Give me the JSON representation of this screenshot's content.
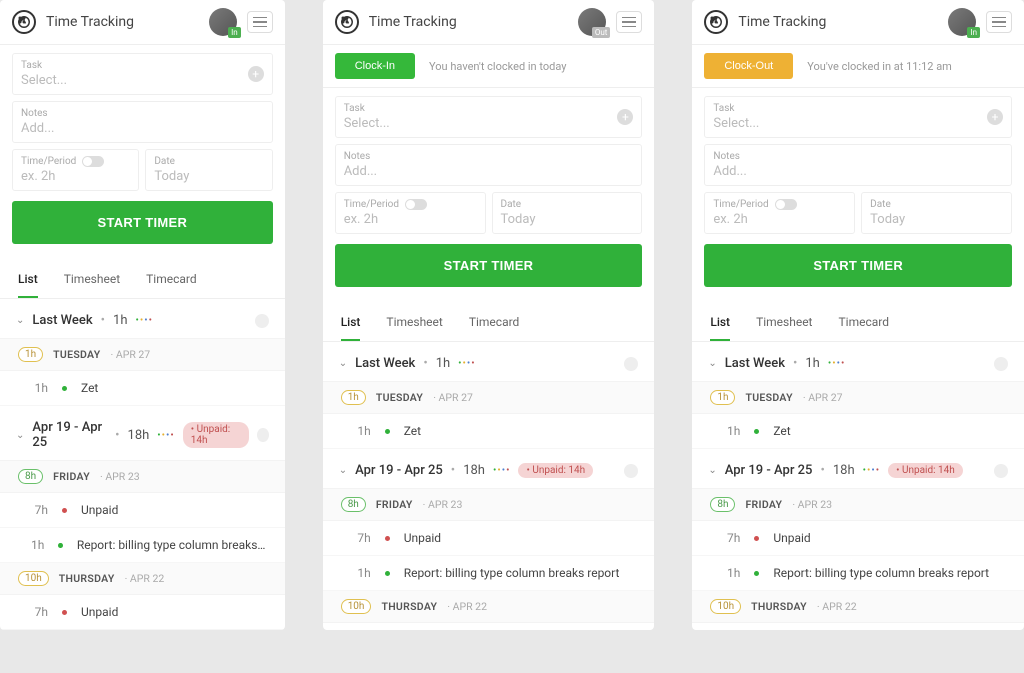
{
  "panels": [
    {
      "title": "Time Tracking",
      "badge": "In",
      "badgeClass": "badge-in",
      "clock": null,
      "form": {
        "task_label": "Task",
        "task_ph": "Select...",
        "notes_label": "Notes",
        "notes_ph": "Add...",
        "time_label": "Time/Period",
        "time_ph": "ex. 2h",
        "date_label": "Date",
        "date_ph": "Today",
        "start": "START TIMER"
      },
      "tabs": [
        "List",
        "Timesheet",
        "Timecard"
      ],
      "active_tab": 0,
      "groups": [
        {
          "name": "Last Week",
          "hours": "1h",
          "dots": "••••",
          "unpaid": null,
          "days": [
            {
              "pill": "1h",
              "pillClass": "",
              "day": "TUESDAY",
              "date": "APR 27",
              "entries": [
                {
                  "h": "1h",
                  "dot": "green",
                  "text": "Zet"
                }
              ]
            }
          ]
        },
        {
          "name": "Apr 19 - Apr 25",
          "hours": "18h",
          "dots": "•••••",
          "unpaid": "Unpaid: 14h",
          "days": [
            {
              "pill": "8h",
              "pillClass": "green",
              "day": "FRIDAY",
              "date": "APR 23",
              "entries": [
                {
                  "h": "7h",
                  "dot": "red",
                  "text": "Unpaid"
                },
                {
                  "h": "1h",
                  "dot": "green",
                  "text": "Report: billing type column breaks report"
                }
              ]
            },
            {
              "pill": "10h",
              "pillClass": "",
              "day": "THURSDAY",
              "date": "APR 22",
              "entries": [
                {
                  "h": "7h",
                  "dot": "red",
                  "text": "Unpaid"
                }
              ]
            }
          ]
        }
      ]
    },
    {
      "title": "Time Tracking",
      "badge": "Out",
      "badgeClass": "badge-out",
      "clock": {
        "btn": "Clock-In",
        "btnClass": "clock-in",
        "text": "You haven't clocked in today"
      },
      "form": {
        "task_label": "Task",
        "task_ph": "Select...",
        "notes_label": "Notes",
        "notes_ph": "Add...",
        "time_label": "Time/Period",
        "time_ph": "ex. 2h",
        "date_label": "Date",
        "date_ph": "Today",
        "start": "START TIMER"
      },
      "tabs": [
        "List",
        "Timesheet",
        "Timecard"
      ],
      "active_tab": 0,
      "groups": [
        {
          "name": "Last Week",
          "hours": "1h",
          "dots": "••••",
          "unpaid": null,
          "days": [
            {
              "pill": "1h",
              "pillClass": "",
              "day": "TUESDAY",
              "date": "APR 27",
              "entries": [
                {
                  "h": "1h",
                  "dot": "green",
                  "text": "Zet"
                }
              ]
            }
          ]
        },
        {
          "name": "Apr 19 - Apr 25",
          "hours": "18h",
          "dots": "•••••",
          "unpaid": "Unpaid: 14h",
          "days": [
            {
              "pill": "8h",
              "pillClass": "green",
              "day": "FRIDAY",
              "date": "APR 23",
              "entries": [
                {
                  "h": "7h",
                  "dot": "red",
                  "text": "Unpaid"
                },
                {
                  "h": "1h",
                  "dot": "green",
                  "text": "Report: billing type column breaks report"
                }
              ]
            },
            {
              "pill": "10h",
              "pillClass": "",
              "day": "THURSDAY",
              "date": "APR 22",
              "entries": []
            }
          ]
        }
      ]
    },
    {
      "title": "Time Tracking",
      "badge": "In",
      "badgeClass": "badge-in",
      "clock": {
        "btn": "Clock-Out",
        "btnClass": "clock-out",
        "text": "You've clocked in at 11:12 am"
      },
      "form": {
        "task_label": "Task",
        "task_ph": "Select...",
        "notes_label": "Notes",
        "notes_ph": "Add...",
        "time_label": "Time/Period",
        "time_ph": "ex. 2h",
        "date_label": "Date",
        "date_ph": "Today",
        "start": "START TIMER"
      },
      "tabs": [
        "List",
        "Timesheet",
        "Timecard"
      ],
      "active_tab": 0,
      "groups": [
        {
          "name": "Last Week",
          "hours": "1h",
          "dots": "••••",
          "unpaid": null,
          "days": [
            {
              "pill": "1h",
              "pillClass": "",
              "day": "TUESDAY",
              "date": "APR 27",
              "entries": [
                {
                  "h": "1h",
                  "dot": "green",
                  "text": "Zet"
                }
              ]
            }
          ]
        },
        {
          "name": "Apr 19 - Apr 25",
          "hours": "18h",
          "dots": "•••••",
          "unpaid": "Unpaid: 14h",
          "days": [
            {
              "pill": "8h",
              "pillClass": "green",
              "day": "FRIDAY",
              "date": "APR 23",
              "entries": [
                {
                  "h": "7h",
                  "dot": "red",
                  "text": "Unpaid"
                },
                {
                  "h": "1h",
                  "dot": "green",
                  "text": "Report: billing type column breaks report"
                }
              ]
            },
            {
              "pill": "10h",
              "pillClass": "",
              "day": "THURSDAY",
              "date": "APR 22",
              "entries": []
            }
          ]
        }
      ]
    }
  ]
}
